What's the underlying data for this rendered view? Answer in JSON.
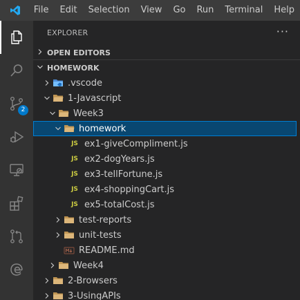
{
  "menu": [
    "File",
    "Edit",
    "Selection",
    "View",
    "Go",
    "Run",
    "Terminal",
    "Help"
  ],
  "activity": {
    "items": [
      {
        "name": "explorer-icon",
        "active": true
      },
      {
        "name": "search-icon"
      },
      {
        "name": "source-control-icon",
        "badge": "2"
      },
      {
        "name": "run-debug-icon"
      },
      {
        "name": "remote-explorer-icon"
      },
      {
        "name": "extensions-icon"
      },
      {
        "name": "pull-requests-icon"
      },
      {
        "name": "edge-devtools-icon"
      }
    ]
  },
  "sidebar": {
    "title": "EXPLORER",
    "more": "···",
    "open_editors": "OPEN EDITORS",
    "workspace": "HOMEWORK"
  },
  "tree": [
    {
      "label": ".vscode",
      "depth": 1,
      "kind": "folder-vscode",
      "twisty": "closed"
    },
    {
      "label": "1-Javascript",
      "depth": 1,
      "kind": "folder",
      "twisty": "open"
    },
    {
      "label": "Week3",
      "depth": 2,
      "kind": "folder",
      "twisty": "open"
    },
    {
      "label": "homework",
      "depth": 3,
      "kind": "folder",
      "twisty": "open",
      "selected": true
    },
    {
      "label": "ex1-giveCompliment.js",
      "depth": 4,
      "kind": "js"
    },
    {
      "label": "ex2-dogYears.js",
      "depth": 4,
      "kind": "js"
    },
    {
      "label": "ex3-tellFortune.js",
      "depth": 4,
      "kind": "js"
    },
    {
      "label": "ex4-shoppingCart.js",
      "depth": 4,
      "kind": "js"
    },
    {
      "label": "ex5-totalCost.js",
      "depth": 4,
      "kind": "js"
    },
    {
      "label": "test-reports",
      "depth": 3,
      "kind": "folder",
      "twisty": "closed"
    },
    {
      "label": "unit-tests",
      "depth": 3,
      "kind": "folder",
      "twisty": "closed"
    },
    {
      "label": "README.md",
      "depth": 3,
      "kind": "md"
    },
    {
      "label": "Week4",
      "depth": 2,
      "kind": "folder",
      "twisty": "closed"
    },
    {
      "label": "2-Browsers",
      "depth": 1,
      "kind": "folder",
      "twisty": "closed"
    },
    {
      "label": "3-UsingAPIs",
      "depth": 1,
      "kind": "folder",
      "twisty": "closed"
    }
  ],
  "icons": {
    "js_label": "JS"
  },
  "colors": {
    "selection": "#094771",
    "accent": "#007acc",
    "folder": "#dcb67a",
    "js": "#cbcb41"
  }
}
